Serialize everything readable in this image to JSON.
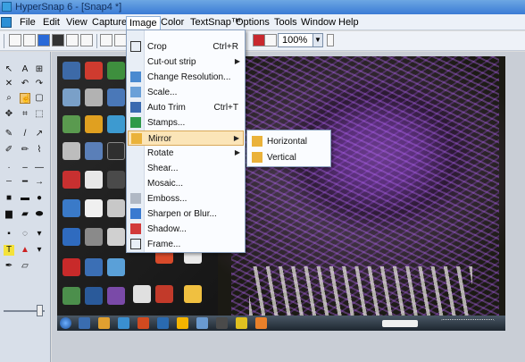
{
  "window": {
    "title": "HyperSnap 6 - [Snap4 *]"
  },
  "menubar": {
    "items": [
      {
        "label": "File"
      },
      {
        "label": "Edit"
      },
      {
        "label": "View"
      },
      {
        "label": "Capture"
      },
      {
        "label": "Image"
      },
      {
        "label": "Color"
      },
      {
        "label": "TextSnap™"
      },
      {
        "label": "Options"
      },
      {
        "label": "Tools"
      },
      {
        "label": "Window"
      },
      {
        "label": "Help"
      }
    ]
  },
  "toolbar": {
    "zoom_value": "100%"
  },
  "image_menu": {
    "items": [
      {
        "label": "Crop",
        "shortcut": "Ctrl+R",
        "icon": "crop-icon"
      },
      {
        "label": "Cut-out strip",
        "shortcut": "",
        "icon": "cutout-icon",
        "submenu": true
      },
      {
        "label": "Change Resolution...",
        "shortcut": "",
        "icon": "resolution-icon"
      },
      {
        "label": "Scale...",
        "shortcut": "",
        "icon": "scale-icon"
      },
      {
        "label": "Auto Trim",
        "shortcut": "Ctrl+T",
        "icon": "autotrim-icon"
      },
      {
        "label": "Stamps...",
        "shortcut": "",
        "icon": "stamps-icon"
      },
      {
        "label": "Mirror",
        "shortcut": "",
        "icon": "mirror-icon",
        "submenu": true,
        "highlighted": true
      },
      {
        "label": "Rotate",
        "shortcut": "",
        "icon": "rotate-icon",
        "submenu": true
      },
      {
        "label": "Shear...",
        "shortcut": "",
        "icon": "shear-icon"
      },
      {
        "label": "Mosaic...",
        "shortcut": "",
        "icon": "mosaic-icon"
      },
      {
        "label": "Emboss...",
        "shortcut": "",
        "icon": "emboss-icon"
      },
      {
        "label": "Sharpen or Blur...",
        "shortcut": "",
        "icon": "sharpen-icon"
      },
      {
        "label": "Shadow...",
        "shortcut": "",
        "icon": "shadow-icon"
      },
      {
        "label": "Frame...",
        "shortcut": "",
        "icon": "frame-icon"
      }
    ]
  },
  "mirror_submenu": {
    "items": [
      {
        "label": "Horizontal",
        "icon": "mirror-horizontal-icon"
      },
      {
        "label": "Vertical",
        "icon": "mirror-vertical-icon"
      }
    ]
  },
  "colors": {
    "menu_highlight": "#fbe5b8",
    "title_bar": "#3a7bd5",
    "thistle_purple": "#8a4fc9"
  }
}
